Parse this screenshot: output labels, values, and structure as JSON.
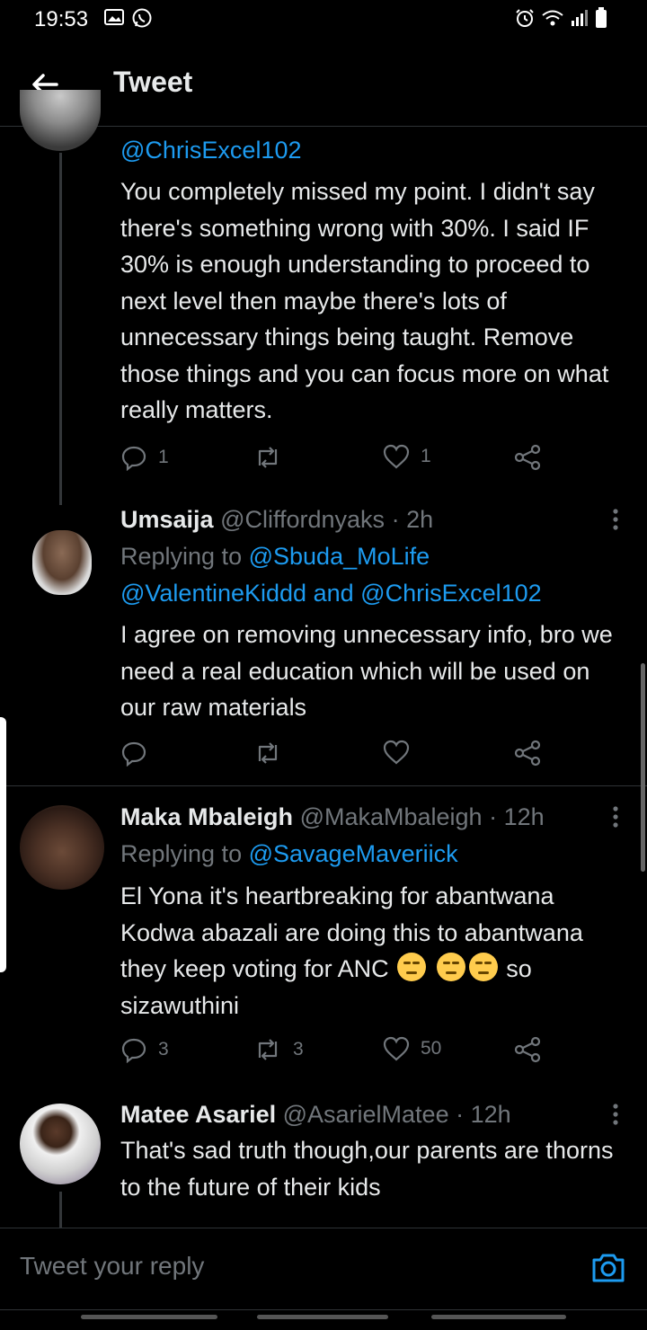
{
  "status_bar": {
    "time": "19:53",
    "left_icons": [
      "gallery-icon",
      "whatsapp-icon"
    ],
    "right_icons": [
      "alarm-icon",
      "wifi-icon",
      "signal-icon",
      "battery-icon"
    ]
  },
  "header": {
    "title": "Tweet",
    "back_icon": "arrow-left-icon"
  },
  "tweets": [
    {
      "reply_to_text": "@ChrisExcel102",
      "text": "You completely missed my point. I didn't say there's something wrong with 30%. I said IF 30% is enough understanding to proceed to next level then maybe there's lots of unnecessary things being taught. Remove those things and you can focus more on what really matters.",
      "replies": "1",
      "retweets": "",
      "likes": "1"
    },
    {
      "name": "Umsaija",
      "handle": "@Cliffordnyaks",
      "time": "· 2h",
      "replying_label": "Replying to",
      "replying_to": "@Sbuda_MoLife",
      "replying_to_2": "@ValentineKiddd",
      "replying_and": "and",
      "replying_to_3": "@ChrisExcel102",
      "text": "I agree on removing unnecessary info, bro we need a real education which will be used on our raw materials",
      "replies": "",
      "retweets": "",
      "likes": ""
    },
    {
      "name": "Maka Mbaleigh",
      "handle": "@MakaMbaleigh",
      "time": "· 12h",
      "replying_label": "Replying to",
      "replying_to": "@SavageMaveriick",
      "text_line1": "El Yona it's heartbreaking for abantwana Kodwa abazali are doing this to abantwana they keep voting for ANC",
      "text_line2": "so sizawuthini",
      "emoji": "unamused-face",
      "replies": "3",
      "retweets": "3",
      "likes": "50"
    },
    {
      "name": "Matee Asariel",
      "handle": "@AsarielMatee",
      "time": "· 12h",
      "text": "That's sad truth though,our parents are thorns to the future of their kids"
    }
  ],
  "reply_box": {
    "placeholder": "Tweet your reply",
    "camera_icon": "camera-icon"
  },
  "colors": {
    "background": "#000000",
    "link": "#1d9bf0",
    "text": "#e7e9ea",
    "muted": "#71767b"
  }
}
